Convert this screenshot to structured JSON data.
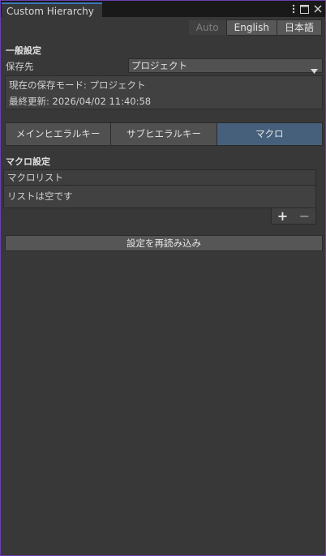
{
  "window": {
    "tab_title": "Custom Hierarchy",
    "icons": [
      "kebab-menu-icon",
      "maximize-icon",
      "close-icon"
    ]
  },
  "language": {
    "options": [
      "Auto",
      "English",
      "日本語"
    ],
    "selected": "English"
  },
  "general": {
    "title": "一般設定",
    "save_location_label": "保存先",
    "save_location_value": "プロジェクト",
    "info_mode": "現在の保存モード: プロジェクト",
    "info_updated": "最終更新: 2026/04/02 11:40:58"
  },
  "tabs": [
    {
      "label": "メインヒエラルキー"
    },
    {
      "label": "サブヒエラルキー"
    },
    {
      "label": "マクロ"
    }
  ],
  "active_tab": "マクロ",
  "macro": {
    "title": "マクロ設定",
    "list_header": "マクロリスト",
    "empty_text": "リストは空です",
    "add_label": "+",
    "remove_label": "−"
  },
  "reload_label": "設定を再読み込み",
  "colors": {
    "background": "#383838",
    "active_tab": "#46607c",
    "window_border": "#6a3fb0"
  }
}
